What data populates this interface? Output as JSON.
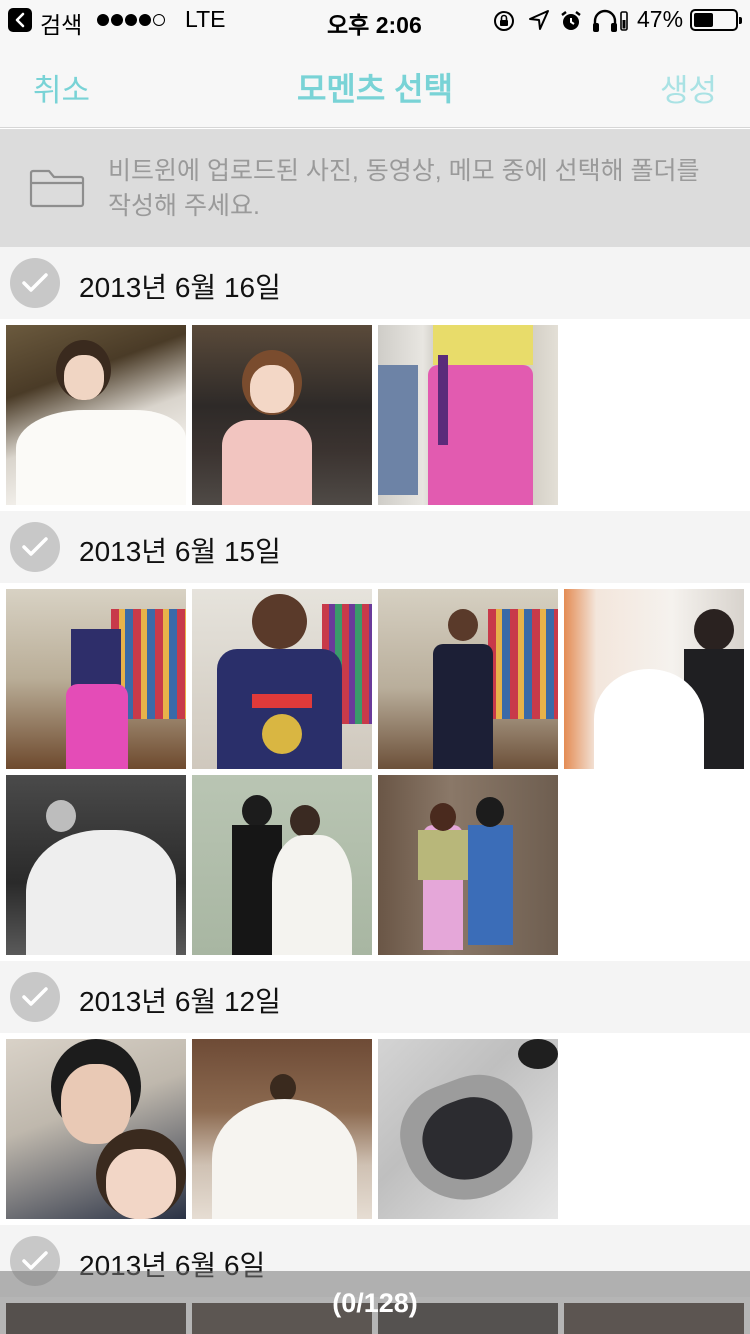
{
  "status_bar": {
    "back_label": "검색",
    "carrier": "LTE",
    "time": "오후 2:06",
    "battery": "47%",
    "battery_level": 0.47,
    "signal_bars_filled": 4,
    "signal_bars_total": 5,
    "icons": [
      "rotation-lock-icon",
      "location-arrow-icon",
      "alarm-icon",
      "headphones-icon",
      "battery-icon"
    ]
  },
  "nav": {
    "cancel_label": "취소",
    "title": "모멘츠 선택",
    "create_label": "생성"
  },
  "info": {
    "text": "비트윈에 업로드된 사진, 동영상, 메모 중에 선택해 폴더를 작성해 주세요.",
    "icon": "folder-icon"
  },
  "sections": [
    {
      "date": "2013년 6월 16일"
    },
    {
      "date": "2013년 6월 15일"
    },
    {
      "date": "2013년 6월 12일"
    },
    {
      "date": "2013년 6월 6일"
    }
  ],
  "footer": {
    "count_text": "(0/128)"
  },
  "colors": {
    "accent": "#79d3d6",
    "accent_disabled": "#a9e2e4",
    "banner_bg": "#dcdcdc",
    "section_bg": "#f4f4f4",
    "check_bg": "#c8c8c8"
  }
}
